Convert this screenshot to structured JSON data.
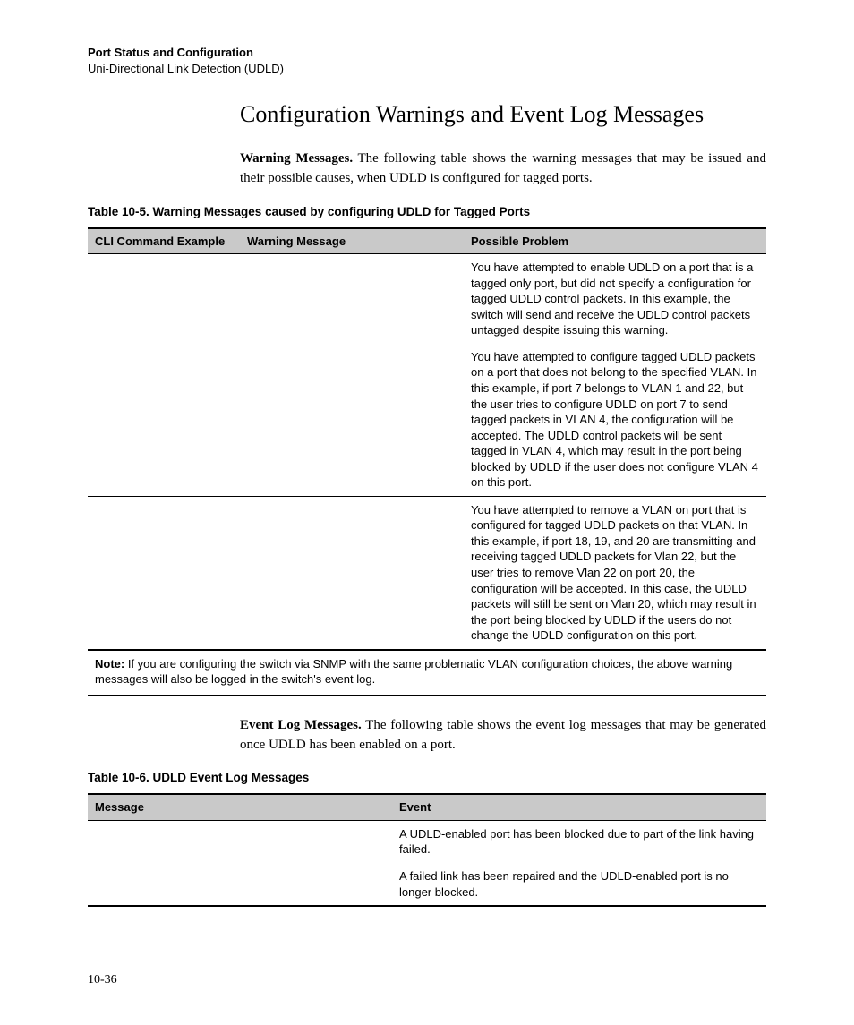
{
  "header": {
    "chapter": "Port Status and Configuration",
    "section": "Uni-Directional Link Detection (UDLD)"
  },
  "title": "Configuration Warnings and Event Log Messages",
  "para1_lead": "Warning Messages.",
  "para1_rest": " The following table shows the warning messages that may be issued and their possible causes, when UDLD is configured for tagged ports.",
  "table1": {
    "caption": "Table 10-5.   Warning Messages caused by configuring UDLD for Tagged Ports",
    "headers": [
      "CLI Command Example",
      "Warning Message",
      "Possible Problem"
    ],
    "rows": [
      {
        "cli": "",
        "msg": "",
        "problem": "You have attempted to enable UDLD on a port that is a tagged only port, but did not specify a configuration for tagged UDLD control packets. In this example, the switch will send and receive the UDLD control packets untagged despite issuing this warning."
      },
      {
        "cli": "",
        "msg": "",
        "problem": "You have attempted to configure tagged UDLD packets on a port that does not belong to the specified VLAN. In this example, if port 7 belongs to VLAN 1 and 22, but the user tries to configure UDLD on port 7 to send tagged packets in VLAN 4, the configuration will be accepted.  The UDLD control packets will be sent tagged in VLAN 4, which may result in the port being blocked by UDLD if the user does not configure VLAN 4 on this port."
      },
      {
        "cli": "",
        "msg": "",
        "problem": "You have attempted to remove a VLAN on port that is configured for tagged UDLD packets on that VLAN. In this example, if port 18, 19, and 20 are transmitting and receiving tagged UDLD packets for Vlan 22, but the user tries to remove Vlan 22 on port 20, the configuration will be accepted.  In this case, the UDLD packets will still be sent on Vlan 20, which may result in the port being blocked by UDLD if the users do not change the UDLD configuration on this port."
      }
    ],
    "note_lead": "Note:",
    "note_rest": "  If you are configuring the switch via SNMP with the same problematic VLAN configuration choices, the above warning messages will also be logged in the switch's event log."
  },
  "para2_lead": "Event Log Messages.",
  "para2_rest": "  The following table shows the event log messages that may be generated once UDLD has been enabled on a port.",
  "table2": {
    "caption": "Table 10-6.   UDLD Event Log Messages",
    "headers": [
      "Message",
      "Event"
    ],
    "rows": [
      {
        "msg": "",
        "event": "A UDLD-enabled port has been blocked due to part of the link having failed."
      },
      {
        "msg": "",
        "event": "A failed link has been repaired and the UDLD-enabled port  is no longer blocked."
      }
    ]
  },
  "page_number": "10-36"
}
